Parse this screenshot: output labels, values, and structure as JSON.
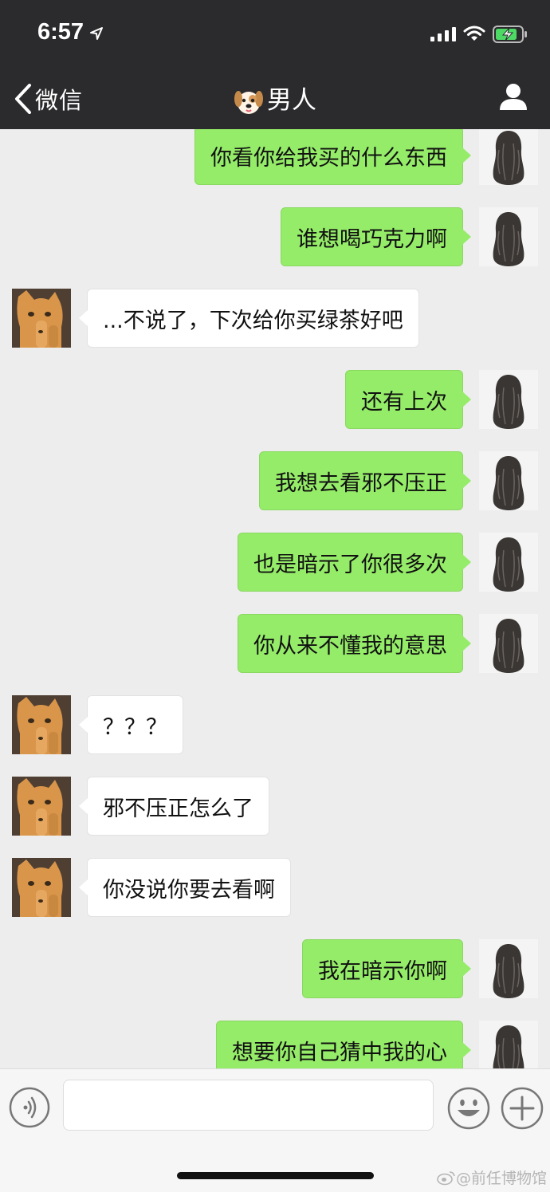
{
  "status": {
    "time": "6:57"
  },
  "header": {
    "back_label": "微信",
    "title": "男人",
    "title_icon": "dog-face-icon"
  },
  "messages": [
    {
      "side": "me",
      "text": "你看你给我买的什么东西",
      "top": 0
    },
    {
      "side": "me",
      "text": "谁想喝巧克力啊"
    },
    {
      "side": "them",
      "text": "...不说了，下次给你买绿茶好吧"
    },
    {
      "side": "me",
      "text": "还有上次"
    },
    {
      "side": "me",
      "text": "我想去看邪不压正"
    },
    {
      "side": "me",
      "text": "也是暗示了你很多次"
    },
    {
      "side": "me",
      "text": "你从来不懂我的意思"
    },
    {
      "side": "them",
      "text": "？？？"
    },
    {
      "side": "them",
      "text": "邪不压正怎么了"
    },
    {
      "side": "them",
      "text": "你没说你要去看啊"
    },
    {
      "side": "me",
      "text": "我在暗示你啊"
    },
    {
      "side": "me",
      "text": "想要你自己猜中我的心"
    }
  ],
  "input": {
    "placeholder": "",
    "value": ""
  },
  "watermark": "@前任博物馆",
  "colors": {
    "header_bg": "#2b2b2d",
    "my_bubble": "#95ec69",
    "their_bubble": "#ffffff",
    "chat_bg": "#ededed"
  }
}
